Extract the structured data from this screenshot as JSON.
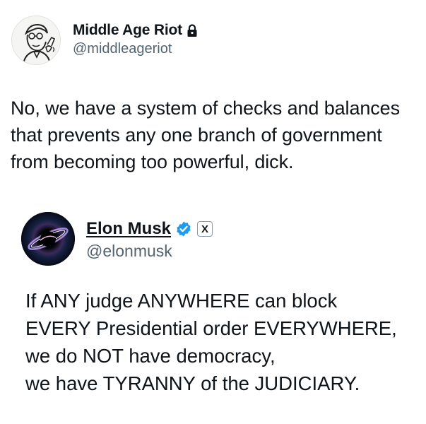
{
  "outer_post": {
    "display_name": "Middle Age Riot",
    "handle": "@middleageriot",
    "lines": [
      "No, we have a system of checks and balances",
      "that prevents any one branch of government",
      "from becoming too powerful, dick."
    ]
  },
  "quoted_post": {
    "display_name": "Elon Musk",
    "handle": "@elonmusk",
    "x_badge": "X",
    "lines": [
      "If ANY judge ANYWHERE can block",
      "EVERY Presidential order EVERYWHERE,",
      "we do NOT have democracy,",
      "we have TYRANNY of the JUDICIARY."
    ]
  },
  "colors": {
    "text": "#0f1419",
    "secondary": "#536471",
    "verified": "#1d9bf0"
  },
  "icons": {
    "protected": "lock-icon",
    "verified": "verified-badge-icon"
  }
}
